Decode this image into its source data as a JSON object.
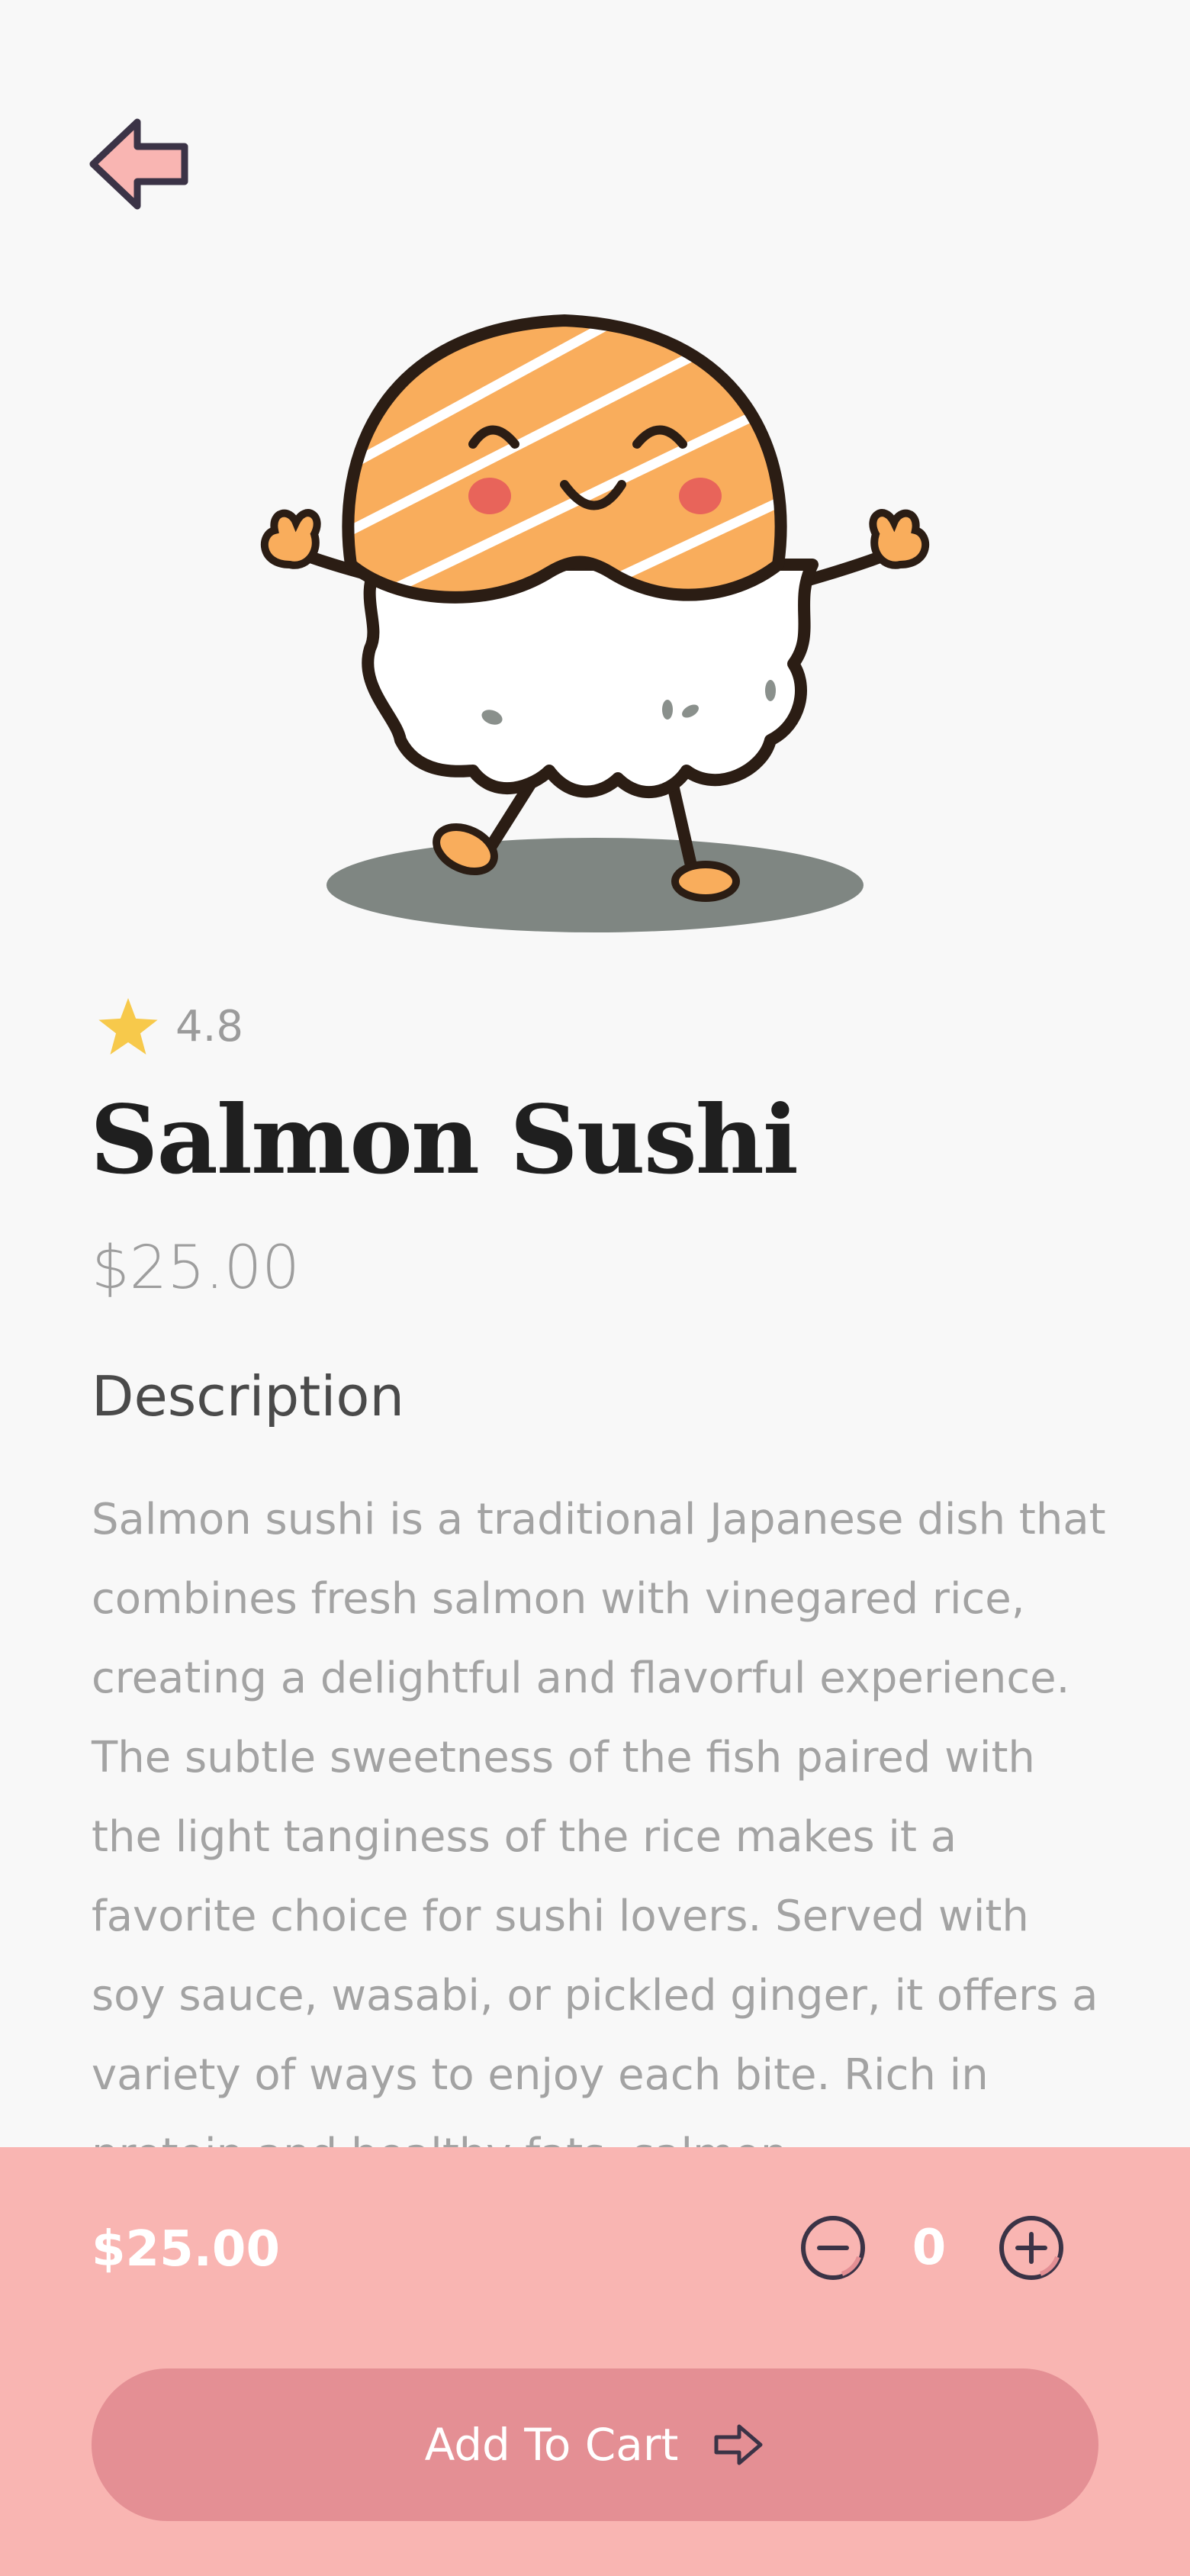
{
  "header": {
    "back_icon": "arrow-left-icon"
  },
  "product": {
    "image_icon": "salmon-sushi-mascot",
    "rating": "4.8",
    "rating_icon": "star-icon",
    "title": "Salmon Sushi",
    "price": "$25.00",
    "description_heading": "Description",
    "description": "Salmon sushi is a traditional Japanese dish that combines fresh salmon with vinegared rice, creating a delightful and flavorful experience. The subtle sweetness of the fish paired with the light tanginess of the rice makes it a favorite choice for sushi lovers. Served with soy sauce, wasabi, or pickled ginger, it offers a variety of ways to enjoy each bite. Rich in protein and healthy fats, salmon"
  },
  "cart": {
    "total": "$25.00",
    "quantity": "0",
    "minus_icon": "minus-circle-icon",
    "plus_icon": "plus-circle-icon",
    "add_label": "Add To Cart",
    "add_icon": "arrow-right-icon"
  },
  "colors": {
    "background": "#f8f8f8",
    "panel": "#f9b5b2",
    "button": "#e48f94",
    "star": "#f7c94b",
    "salmon": "#f9ad5c",
    "outline": "#2b1d14"
  }
}
